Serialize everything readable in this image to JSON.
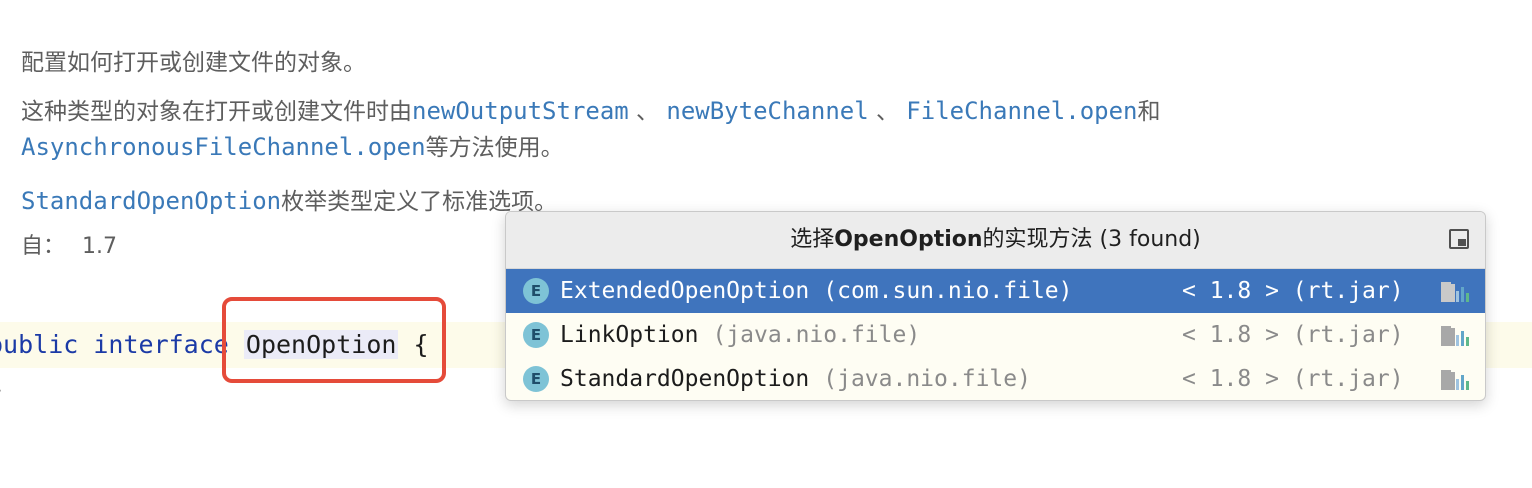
{
  "doc": {
    "line1": "配置如何打开或创建文件的对象。",
    "line2_prefix": "这种类型的对象在打开或创建文件时由",
    "link_newOutputStream": "newOutputStream",
    "sep1": " 、 ",
    "link_newByteChannel": "newByteChannel",
    "sep2": " 、 ",
    "link_fileChannelOpen": "FileChannel.open",
    "line2_suffix": "和",
    "link_asyncOpen": "AsynchronousFileChannel.open",
    "line3_suffix": "等方法使用。",
    "link_standardOpenOption": "StandardOpenOption",
    "line4_suffix": "枚举类型定义了标准选项。",
    "since_label": "自：",
    "since_value": "1.7"
  },
  "code": {
    "kw_public": "public",
    "kw_interface": "interface",
    "identifier": "OpenOption",
    "open_brace": "{",
    "close_brace": "}"
  },
  "popup": {
    "title_prefix": "选择",
    "title_bold": "OpenOption",
    "title_middle": "的实现方法",
    "title_count": " (3 found)",
    "items": [
      {
        "icon": "E",
        "name": "ExtendedOpenOption",
        "package": "(com.sun.nio.file)",
        "version": "< 1.8 > (rt.jar)",
        "selected": true
      },
      {
        "icon": "E",
        "name": "LinkOption",
        "package": "(java.nio.file)",
        "version": "< 1.8 > (rt.jar)",
        "selected": false
      },
      {
        "icon": "E",
        "name": "StandardOpenOption",
        "package": "(java.nio.file)",
        "version": "< 1.8 > (rt.jar)",
        "selected": false
      }
    ]
  },
  "colors": {
    "link": "#3a79b8",
    "keyword": "#1b3aa6",
    "selection": "#3f74bd",
    "highlight_box": "#e54b3a",
    "enum_icon": "#7ec3d6"
  }
}
